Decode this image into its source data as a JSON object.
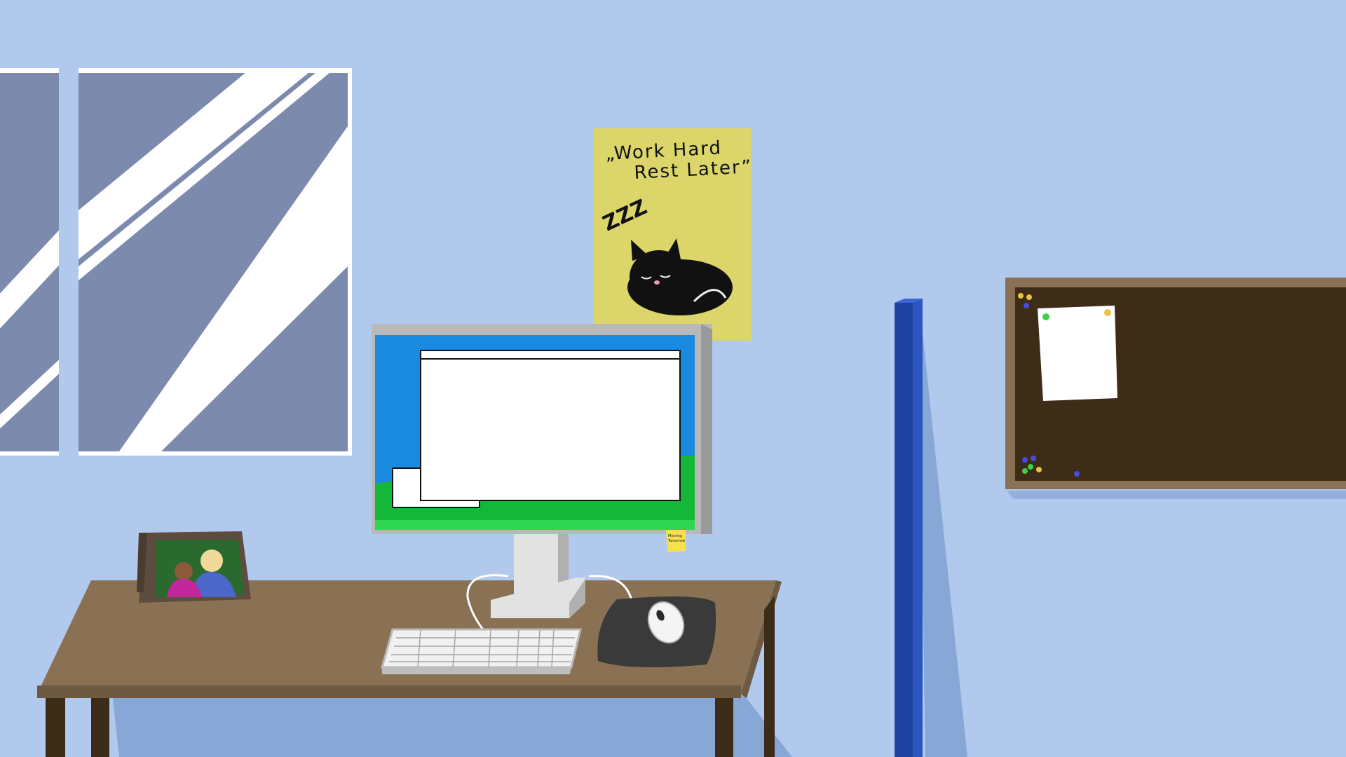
{
  "poster": {
    "line1": "„Work Hard",
    "line2": "Rest Later”",
    "zzz": "ZZZ"
  },
  "sticky_note": {
    "line1": "Meeting",
    "line2": "Tomorrow"
  },
  "colors": {
    "wall": "#b2c9ee",
    "window_glass": "#7b8aad",
    "poster": "#dcd66a",
    "desk": "#8a7153",
    "monitor_screen": "#1a8ae0",
    "monitor_grass": "#14b838",
    "corkboard": "#3d2c17",
    "pole": "#1f42a0"
  },
  "icons": {
    "cat": "sleeping-cat-icon",
    "photo": "family-photo"
  }
}
